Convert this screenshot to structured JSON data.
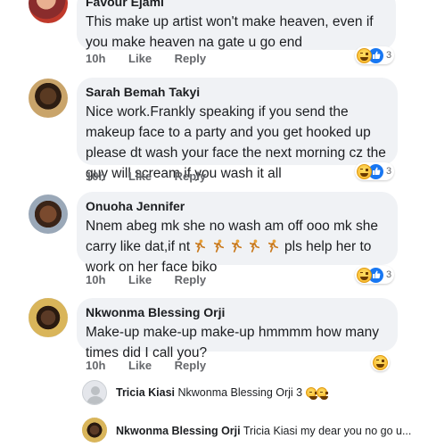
{
  "comments": [
    {
      "author": "Favour Ejami",
      "text": "This make up artist won't make heaven, even if you make heaven na gate u go end",
      "time": "10h",
      "like": "Like",
      "reply": "Reply",
      "reaction_count": "3"
    },
    {
      "author": "Sarah Bemah Takyi",
      "text": "Nice work.Frankly speaking if you send the makeup face to a party and you get hooked up please dt wash your face the next morning cz the guy will scream if you wash it all",
      "time": "10h",
      "like": "Like",
      "reply": "Reply",
      "reaction_count": "3"
    },
    {
      "author": "Onuoha Jennifer",
      "text_before": "Nnem abeg mk she no wash am off ooo mk she carry like dat,if nt",
      "text_after": "pls help her to work on her face biko",
      "time": "10h",
      "like": "Like",
      "reply": "Reply",
      "reaction_count": "3"
    },
    {
      "author": "Nkwonma Blessing Orji",
      "text": "Make-up make-up make-up hmmmm how many times did I call you?",
      "time": "10h",
      "like": "Like",
      "reply": "Reply"
    }
  ],
  "replies": [
    {
      "author": "Tricia Kiasi",
      "text": "Nkwonma Blessing Orji 3"
    },
    {
      "author": "Nkwonma Blessing Orji",
      "text": "Tricia Kiasi my dear you no go u..."
    }
  ],
  "colors": {
    "bubble": "#f0f2f5",
    "like_blue": "#1877f2",
    "meta_gray": "#65676b"
  }
}
